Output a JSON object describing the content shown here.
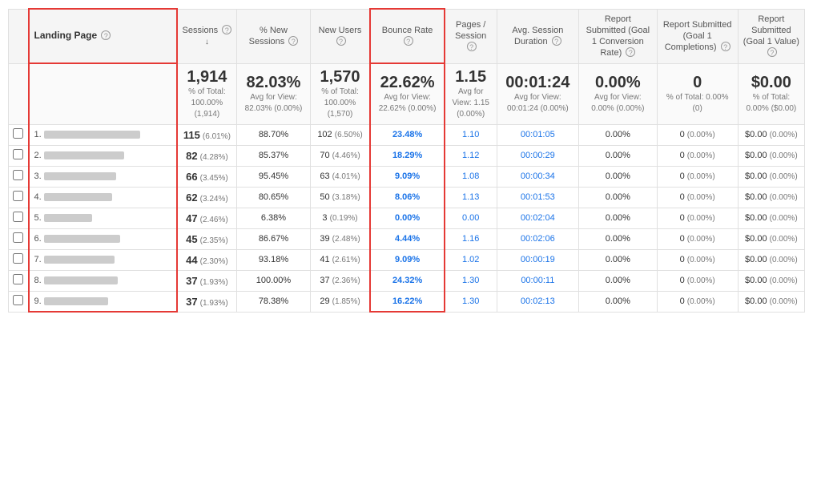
{
  "table": {
    "headers": [
      {
        "id": "checkbox",
        "label": ""
      },
      {
        "id": "landing_page",
        "label": "Landing Page",
        "highlight": true
      },
      {
        "id": "sessions",
        "label": "Sessions",
        "sublabel": "↓"
      },
      {
        "id": "pct_new_sessions",
        "label": "% New Sessions"
      },
      {
        "id": "new_users",
        "label": "New Users"
      },
      {
        "id": "bounce_rate",
        "label": "Bounce Rate",
        "highlight": true
      },
      {
        "id": "pages_session",
        "label": "Pages / Session"
      },
      {
        "id": "avg_session",
        "label": "Avg. Session Duration"
      },
      {
        "id": "report_submitted_rate",
        "label": "Report Submitted (Goal 1 Conversion Rate)"
      },
      {
        "id": "report_submitted_completions",
        "label": "Report Submitted (Goal 1 Completions)"
      },
      {
        "id": "report_submitted_value",
        "label": "Report Submitted (Goal 1 Value)"
      }
    ],
    "totals": {
      "sessions_main": "1,914",
      "sessions_sub": "% of Total: 100.00% (1,914)",
      "pct_new_main": "82.03%",
      "pct_new_sub": "Avg for View: 82.03% (0.00%)",
      "new_users_main": "1,570",
      "new_users_sub": "% of Total: 100.00% (1,570)",
      "bounce_main": "22.62%",
      "bounce_sub": "Avg for View: 22.62% (0.00%)",
      "pages_main": "1.15",
      "pages_sub": "Avg for View: 1.15 (0.00%)",
      "avg_session_main": "00:01:24",
      "avg_session_sub": "Avg for View: 00:01:24 (0.00%)",
      "report_rate_main": "0.00%",
      "report_rate_sub": "Avg for View: 0.00% (0.00%)",
      "report_comp_main": "0",
      "report_comp_sub": "% of Total: 0.00% (0)",
      "report_val_main": "$0.00",
      "report_val_sub": "% of Total: 0.00% ($0.00)"
    },
    "rows": [
      {
        "num": "1.",
        "link_width": "120",
        "sessions": "115",
        "sessions_pct": "(6.01%)",
        "pct_new": "88.70%",
        "new_users": "102",
        "new_users_pct": "(6.50%)",
        "bounce": "23.48%",
        "pages": "1.10",
        "avg_session": "00:01:05",
        "report_rate": "0.00%",
        "report_comp": "0",
        "report_comp_pct": "(0.00%)",
        "report_val": "$0.00",
        "report_val_pct": "(0.00%)"
      },
      {
        "num": "2.",
        "link_width": "100",
        "sessions": "82",
        "sessions_pct": "(4.28%)",
        "pct_new": "85.37%",
        "new_users": "70",
        "new_users_pct": "(4.46%)",
        "bounce": "18.29%",
        "pages": "1.12",
        "avg_session": "00:00:29",
        "report_rate": "0.00%",
        "report_comp": "0",
        "report_comp_pct": "(0.00%)",
        "report_val": "$0.00",
        "report_val_pct": "(0.00%)"
      },
      {
        "num": "3.",
        "link_width": "90",
        "sessions": "66",
        "sessions_pct": "(3.45%)",
        "pct_new": "95.45%",
        "new_users": "63",
        "new_users_pct": "(4.01%)",
        "bounce": "9.09%",
        "pages": "1.08",
        "avg_session": "00:00:34",
        "report_rate": "0.00%",
        "report_comp": "0",
        "report_comp_pct": "(0.00%)",
        "report_val": "$0.00",
        "report_val_pct": "(0.00%)"
      },
      {
        "num": "4.",
        "link_width": "85",
        "sessions": "62",
        "sessions_pct": "(3.24%)",
        "pct_new": "80.65%",
        "new_users": "50",
        "new_users_pct": "(3.18%)",
        "bounce": "8.06%",
        "pages": "1.13",
        "avg_session": "00:01:53",
        "report_rate": "0.00%",
        "report_comp": "0",
        "report_comp_pct": "(0.00%)",
        "report_val": "$0.00",
        "report_val_pct": "(0.00%)"
      },
      {
        "num": "5.",
        "link_width": "60",
        "sessions": "47",
        "sessions_pct": "(2.46%)",
        "pct_new": "6.38%",
        "new_users": "3",
        "new_users_pct": "(0.19%)",
        "bounce": "0.00%",
        "pages": "0.00",
        "avg_session": "00:02:04",
        "report_rate": "0.00%",
        "report_comp": "0",
        "report_comp_pct": "(0.00%)",
        "report_val": "$0.00",
        "report_val_pct": "(0.00%)"
      },
      {
        "num": "6.",
        "link_width": "95",
        "sessions": "45",
        "sessions_pct": "(2.35%)",
        "pct_new": "86.67%",
        "new_users": "39",
        "new_users_pct": "(2.48%)",
        "bounce": "4.44%",
        "pages": "1.16",
        "avg_session": "00:02:06",
        "report_rate": "0.00%",
        "report_comp": "0",
        "report_comp_pct": "(0.00%)",
        "report_val": "$0.00",
        "report_val_pct": "(0.00%)"
      },
      {
        "num": "7.",
        "link_width": "88",
        "sessions": "44",
        "sessions_pct": "(2.30%)",
        "pct_new": "93.18%",
        "new_users": "41",
        "new_users_pct": "(2.61%)",
        "bounce": "9.09%",
        "pages": "1.02",
        "avg_session": "00:00:19",
        "report_rate": "0.00%",
        "report_comp": "0",
        "report_comp_pct": "(0.00%)",
        "report_val": "$0.00",
        "report_val_pct": "(0.00%)"
      },
      {
        "num": "8.",
        "link_width": "92",
        "sessions": "37",
        "sessions_pct": "(1.93%)",
        "pct_new": "100.00%",
        "new_users": "37",
        "new_users_pct": "(2.36%)",
        "bounce": "24.32%",
        "pages": "1.30",
        "avg_session": "00:00:11",
        "report_rate": "0.00%",
        "report_comp": "0",
        "report_comp_pct": "(0.00%)",
        "report_val": "$0.00",
        "report_val_pct": "(0.00%)"
      },
      {
        "num": "9.",
        "link_width": "80",
        "sessions": "37",
        "sessions_pct": "(1.93%)",
        "pct_new": "78.38%",
        "new_users": "29",
        "new_users_pct": "(1.85%)",
        "bounce": "16.22%",
        "pages": "1.30",
        "avg_session": "00:02:13",
        "report_rate": "0.00%",
        "report_comp": "0",
        "report_comp_pct": "(0.00%)",
        "report_val": "$0.00",
        "report_val_pct": "(0.00%)"
      }
    ]
  }
}
